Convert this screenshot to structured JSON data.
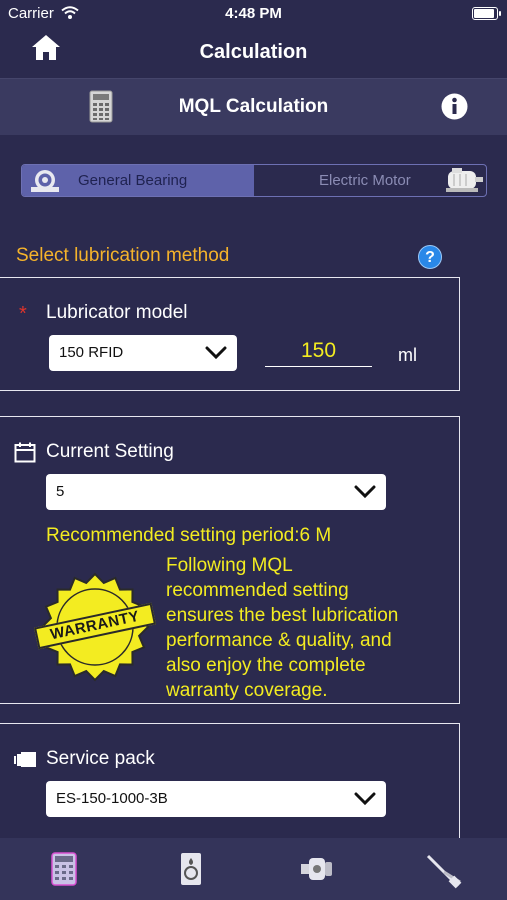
{
  "status_bar": {
    "carrier": "Carrier",
    "time": "4:48 PM",
    "battery_level": 1.0
  },
  "nav": {
    "title": "Calculation",
    "home_icon": "home-icon"
  },
  "sub_header": {
    "title": "MQL Calculation",
    "left_icon": "calculator-icon",
    "right_icon": "info-icon"
  },
  "segment": {
    "options": [
      "General Bearing",
      "Electric Motor"
    ],
    "selected": "General Bearing"
  },
  "lubrication": {
    "section_title": "Select lubrication method",
    "help_icon": "?",
    "required_mark": "*",
    "lubricator_label": "Lubricator model",
    "lubricator_value": "150 RFID",
    "volume_value": "150",
    "volume_unit": "ml"
  },
  "current_setting": {
    "label": "Current Setting",
    "value": "5",
    "recommended": "Recommended setting period:6 M",
    "warranty_badge": "WARRANTY",
    "note_lines": [
      "Following MQL",
      "recommended setting",
      "ensures the best lubrication",
      "performance & quality, and",
      "also enjoy the complete",
      "warranty coverage."
    ]
  },
  "service_pack": {
    "label": "Service pack",
    "value": "ES-150-1000-3B"
  },
  "tab_bar": {
    "items": [
      "calculator-tab",
      "lubricator-tab",
      "motor-tab",
      "tools-tab"
    ],
    "active": "calculator-tab"
  },
  "colors": {
    "background": "#2b2a4e",
    "accent": "#f5b32b",
    "highlight": "#f3ec21",
    "segment_active": "#5e62aa"
  }
}
